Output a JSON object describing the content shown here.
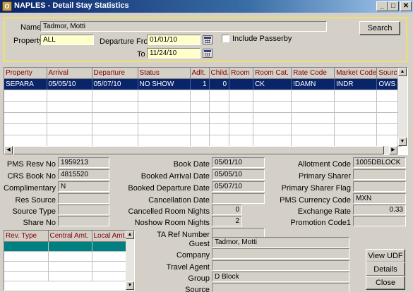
{
  "title": "NAPLES - Detail Stay Statistics",
  "window_controls": {
    "minimize": "_",
    "maximize": "□",
    "close": "✕"
  },
  "search": {
    "name_label": "Name",
    "name_value": "Tadmor, Motti",
    "property_label": "Property",
    "property_value": "ALL",
    "departure_from_label": "Departure From",
    "departure_from_value": "01/01/10",
    "to_label": "To",
    "to_value": "11/24/10",
    "include_passerby_label": "Include Passerby",
    "search_button": "Search"
  },
  "grid": {
    "columns": [
      "Property",
      "Arrival",
      "Departure",
      "Status",
      "Adlt.",
      "Child.",
      "Room",
      "Room Cat.",
      "Rate Code",
      "Market Code",
      "Source"
    ],
    "rows": [
      [
        "SEPARA",
        "05/05/10",
        "05/07/10",
        "NO SHOW",
        "1",
        "0",
        "",
        "CK",
        "!DAMN",
        "INDR",
        "OWS"
      ]
    ]
  },
  "details": {
    "pms_resv_no_label": "PMS Resv No",
    "pms_resv_no": "1959213",
    "crs_book_no_label": "CRS Book No",
    "crs_book_no": "4815520",
    "complimentary_label": "Complimentary",
    "complimentary": "N",
    "res_source_label": "Res Source",
    "res_source": "",
    "source_type_label": "Source Type",
    "source_type": "",
    "share_no_label": "Share No",
    "share_no": "",
    "book_date_label": "Book Date",
    "book_date": "05/01/10",
    "booked_arrival_label": "Booked Arrival Date",
    "booked_arrival": "05/05/10",
    "booked_departure_label": "Booked Departure Date",
    "booked_departure": "05/07/10",
    "cancellation_date_label": "Cancellation Date",
    "cancellation_date": "",
    "cancelled_room_nights_label": "Cancelled Room Nights",
    "cancelled_room_nights": "0",
    "noshow_room_nights_label": "Noshow Room Nights",
    "noshow_room_nights": "2",
    "ta_ref_label": "TA Ref Number",
    "ta_ref": "",
    "allotment_code_label": "Allotment Code",
    "allotment_code": "1005DBLOCK",
    "primary_sharer_label": "Primary Sharer",
    "primary_sharer": "",
    "primary_sharer_flag_label": "Primary Sharer Flag",
    "primary_sharer_flag": "",
    "pms_currency_label": "PMS Currency Code",
    "pms_currency": "MXN",
    "exchange_rate_label": "Exchange Rate",
    "exchange_rate": "0.33",
    "promotion_code_label": "Promotion Code1",
    "promotion_code": "",
    "guest_label": "Guest",
    "guest": "Tadmor, Motti",
    "company_label": "Company",
    "company": "",
    "travel_agent_label": "Travel Agent",
    "travel_agent": "",
    "group_label": "Group",
    "group": "D Block",
    "source_label": "Source",
    "source": ""
  },
  "revenue": {
    "columns": [
      "Rev. Type",
      "Central Amt.",
      "Local Amt."
    ]
  },
  "buttons": {
    "view_udf": "View UDF",
    "details": "Details",
    "close": "Close"
  }
}
